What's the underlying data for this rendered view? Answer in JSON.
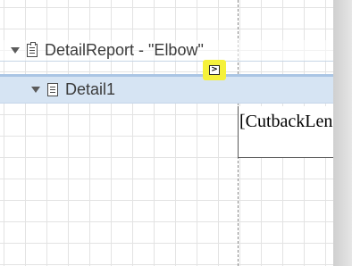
{
  "bands": {
    "detail_report": {
      "label": "DetailReport - \"Elbow\"",
      "expanded": true,
      "icon": "report-clipboard-icon"
    },
    "detail": {
      "label": "Detail1",
      "expanded": true,
      "selected": true,
      "icon": "detail-band-icon"
    }
  },
  "smart_tag": {
    "glyph": ">",
    "icon": "smart-tag-icon",
    "highlight_color": "#f5f13a"
  },
  "controls": {
    "field": {
      "text": "[CutbackLength]"
    }
  },
  "colors": {
    "selected_band": "#d6e4f3",
    "grid": "#e3e3e3"
  }
}
